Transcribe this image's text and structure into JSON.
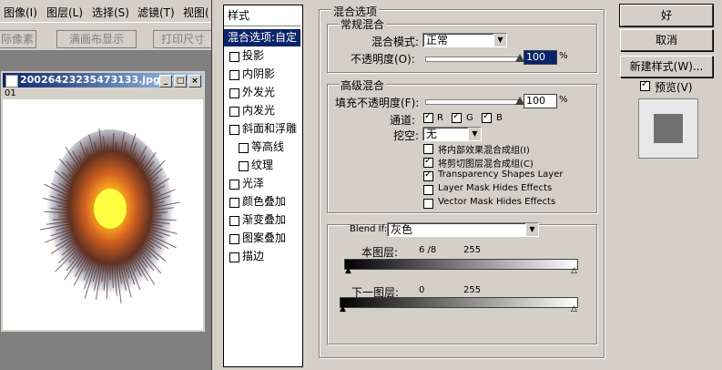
{
  "menu": [
    "图像(I)",
    "图层(L)",
    "选择(S)",
    "滤镜(T)",
    "视图("
  ],
  "options_bar": [
    "际像素",
    "满画布显示",
    "打印尺寸"
  ],
  "document": {
    "title": "20026423235473133.jpg @ ...",
    "status": "01"
  },
  "styles": {
    "header": "样式",
    "items": [
      {
        "label": "混合选项:自定",
        "selected": true,
        "has_checkbox": false
      },
      {
        "label": "投影"
      },
      {
        "label": "内阴影"
      },
      {
        "label": "外发光"
      },
      {
        "label": "内发光"
      },
      {
        "label": "斜面和浮雕"
      },
      {
        "label": "等高线",
        "indent": true
      },
      {
        "label": "纹理",
        "indent": true
      },
      {
        "label": "光泽"
      },
      {
        "label": "颜色叠加"
      },
      {
        "label": "渐变叠加"
      },
      {
        "label": "图案叠加"
      },
      {
        "label": "描边"
      }
    ]
  },
  "blending": {
    "title": "混合选项",
    "general": {
      "title": "常规混合",
      "mode_label": "混合模式:",
      "mode_value": "正常",
      "opacity_label": "不透明度(O):",
      "opacity_value": "100",
      "unit": "%"
    },
    "advanced": {
      "title": "高级混合",
      "fill_label": "填充不透明度(F):",
      "fill_value": "100",
      "unit": "%",
      "channels_label": "通道:",
      "channels": [
        "R",
        "G",
        "B"
      ],
      "knockout_label": "挖空:",
      "knockout_value": "无",
      "options": [
        {
          "label": "将内部效果混合成组(I)",
          "checked": false
        },
        {
          "label": "将剪切图层混合成组(C)",
          "checked": true
        },
        {
          "label": "Transparency Shapes Layer",
          "checked": true
        },
        {
          "label": "Layer Mask Hides Effects",
          "checked": false
        },
        {
          "label": "Vector Mask Hides Effects",
          "checked": false
        }
      ]
    },
    "blend_if": {
      "label": "Blend If:",
      "value": "灰色",
      "this_layer_label": "本图层:",
      "this_layer_low": "6 /8",
      "this_layer_high": "255",
      "underlying_label": "下一图层:",
      "underlying_low": "0",
      "underlying_high": "255"
    }
  },
  "buttons": {
    "ok": "好",
    "cancel": "取消",
    "new_style": "新建样式(W)...",
    "preview": "预览(V)"
  },
  "colors": {
    "selection": "#0a246a",
    "dialog_bg": "#d4d0c8",
    "preview_swatch": "#707070"
  }
}
